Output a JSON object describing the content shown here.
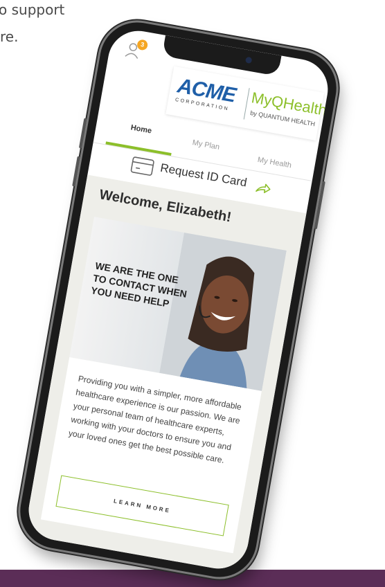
{
  "background": {
    "line1": "o support",
    "line2": "re."
  },
  "notifications": {
    "count": "3"
  },
  "logo": {
    "acme": "ACME",
    "acme_sub": "CORPORATION",
    "myq": "MyQHealth.",
    "myq_sub": "by QUANTUM HEALTH"
  },
  "tabs": [
    {
      "label": "Home"
    },
    {
      "label": "My Plan"
    },
    {
      "label": "My Health"
    }
  ],
  "request": {
    "label": "Request ID Card"
  },
  "welcome": "Welcome, Elizabeth!",
  "hero": {
    "lines": [
      "WE ARE THE ONE",
      "TO CONTACT WHEN",
      "YOU NEED HELP"
    ]
  },
  "description": "Providing you with a simpler, more affordable healthcare experience is our passion. We are your personal team of healthcare experts, working with your doctors to ensure you and your loved ones get the best possible care.",
  "learn_more": "LEARN MORE",
  "colors": {
    "accent_green": "#8cbf2a",
    "acme_blue": "#1f5fa8",
    "badge": "#f5a623",
    "footer": "#5b2d57"
  }
}
